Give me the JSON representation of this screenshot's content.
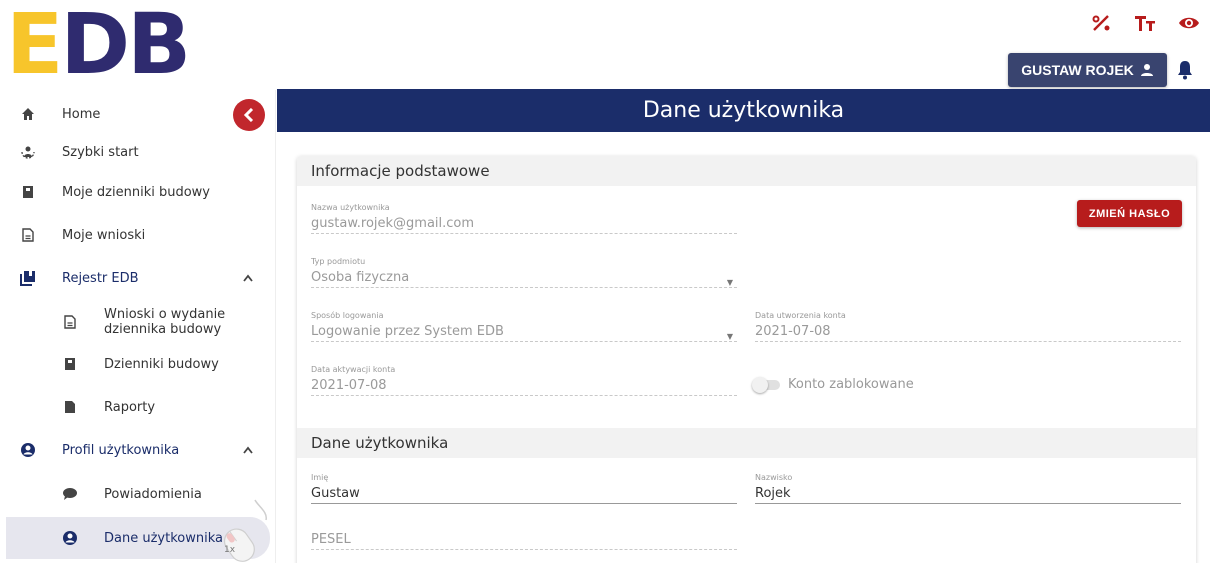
{
  "header": {
    "logo_e": "E",
    "logo_db": "DB",
    "user_button": "GUSTAW ROJEK",
    "icons": [
      "contrast-icon",
      "text-size-icon",
      "eye-icon",
      "user-icon",
      "bell-icon"
    ],
    "accent_color": "#b71c1c",
    "navy_color": "#1b2d6a"
  },
  "sidebar": {
    "items": [
      {
        "label": "Home",
        "icon": "home-icon"
      },
      {
        "label": "Szybki start",
        "icon": "quick-start-icon"
      },
      {
        "label": "Moje dzienniki budowy",
        "icon": "book-icon"
      },
      {
        "label": "Moje wnioski",
        "icon": "document-icon"
      },
      {
        "label": "Rejestr EDB",
        "icon": "registry-icon",
        "expanded": true
      },
      {
        "label_line1": "Wnioski o wydanie",
        "label_line2": "dziennika budowy",
        "icon": "document-icon"
      },
      {
        "label": "Dzienniki budowy",
        "icon": "book-icon"
      },
      {
        "label": "Raporty",
        "icon": "file-icon"
      },
      {
        "label": "Profil użytkownika",
        "icon": "user-circle-icon",
        "expanded": true
      },
      {
        "label": "Powiadomienia",
        "icon": "chat-icon"
      },
      {
        "label": "Dane użytkownika",
        "icon": "user-circle-icon",
        "active": true
      }
    ],
    "mouse_hint": "1x"
  },
  "main": {
    "title": "Dane użytkownika",
    "section1": {
      "title": "Informacje podstawowe",
      "username_label": "Nazwa użytkownika",
      "username_value": "gustaw.rojek@gmail.com",
      "change_password": "ZMIEŃ HASŁO",
      "entity_type_label": "Typ podmiotu",
      "entity_type_value": "Osoba fizyczna",
      "login_method_label": "Sposób logowania",
      "login_method_value": "Logowanie przez System EDB",
      "created_label": "Data utworzenia konta",
      "created_value": "2021-07-08",
      "activated_label": "Data aktywacji konta",
      "activated_value": "2021-07-08",
      "blocked_label": "Konto zablokowane",
      "blocked": false
    },
    "section2": {
      "title": "Dane użytkownika",
      "first_name_label": "Imię",
      "first_name_value": "Gustaw",
      "last_name_label": "Nazwisko",
      "last_name_value": "Rojek",
      "pesel_placeholder": "PESEL"
    }
  }
}
